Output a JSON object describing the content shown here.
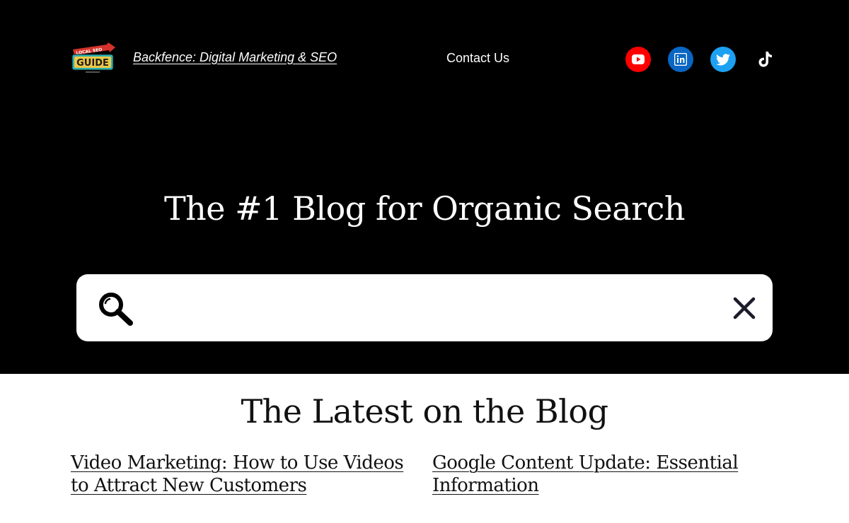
{
  "header": {
    "logo_text_top": "LOCAL SEO",
    "logo_text_main": "GUIDE",
    "site_title": "Backfence: Digital Marketing & SEO",
    "contact_label": "Contact Us",
    "social": [
      {
        "name": "youtube",
        "icon": "youtube-icon",
        "color": "#ff0000"
      },
      {
        "name": "linkedin",
        "icon": "linkedin-icon",
        "color": "#0a66c2"
      },
      {
        "name": "twitter",
        "icon": "twitter-icon",
        "color": "#1da1f2"
      },
      {
        "name": "tiktok",
        "icon": "tiktok-icon",
        "color": "#000000"
      }
    ]
  },
  "hero": {
    "title": "The #1 Blog for Organic Search",
    "search": {
      "value": "",
      "placeholder": "",
      "search_icon": "magnifier-icon",
      "clear_icon": "close-icon"
    }
  },
  "latest": {
    "title": "The Latest on the Blog",
    "posts": [
      {
        "title": "Video Marketing: How to Use Videos to Attract New Customers"
      },
      {
        "title": "Google Content Update: Essential Information"
      }
    ]
  },
  "colors": {
    "hero_background": "#000000",
    "page_background": "#ffffff",
    "text_light": "#ffffff",
    "text_dark": "#111111"
  }
}
